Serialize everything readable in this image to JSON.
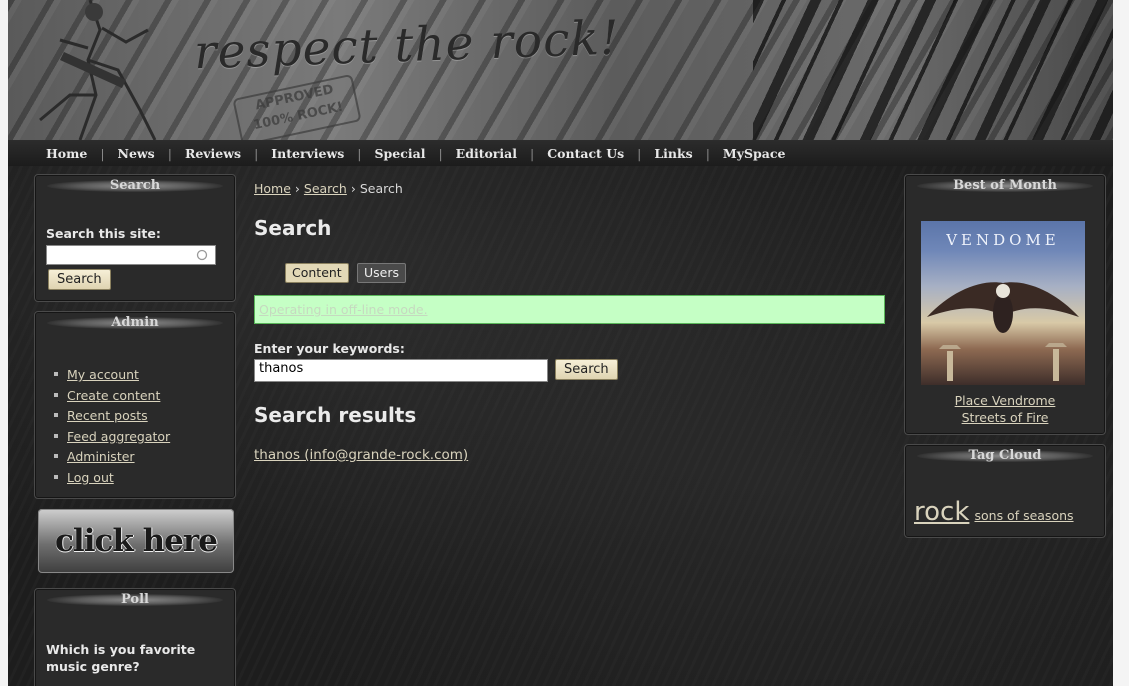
{
  "header": {
    "tagline": "respect the rock!",
    "stamp_line1": "APPROVED",
    "stamp_line2": "100% ROCK!"
  },
  "nav": {
    "items": [
      "Home",
      "News",
      "Reviews",
      "Interviews",
      "Special",
      "Editorial",
      "Contact Us",
      "Links",
      "MySpace"
    ]
  },
  "search_block": {
    "title": "Search",
    "label": "Search this site:",
    "input_value": "",
    "button": "Search"
  },
  "admin_block": {
    "title": "Admin",
    "items": [
      "My account",
      "Create content",
      "Recent posts",
      "Feed aggregator",
      "Administer",
      "Log out"
    ]
  },
  "banner": {
    "text": "click here"
  },
  "poll_block": {
    "title": "Poll",
    "question": "Which is you favorite music genre?"
  },
  "main": {
    "breadcrumb": [
      "Home",
      "Search",
      "Search"
    ],
    "breadcrumb_sep": "›",
    "title": "Search",
    "tabs": [
      {
        "label": "Content",
        "active": true
      },
      {
        "label": "Users",
        "active": false
      }
    ],
    "notice": "Operating in off-line mode.",
    "keywords_label": "Enter your keywords:",
    "keywords_value": "thanos",
    "search_button": "Search",
    "results_title": "Search results",
    "results": [
      "thanos (info@grande-rock.com)"
    ]
  },
  "best_block": {
    "title": "Best of Month",
    "album_art_text": "VENDOME",
    "album_artist": "Place Vendrome",
    "album_title": "Streets of Fire"
  },
  "tag_block": {
    "title": "Tag Cloud",
    "tags": [
      "rock",
      "sons of seasons"
    ]
  }
}
